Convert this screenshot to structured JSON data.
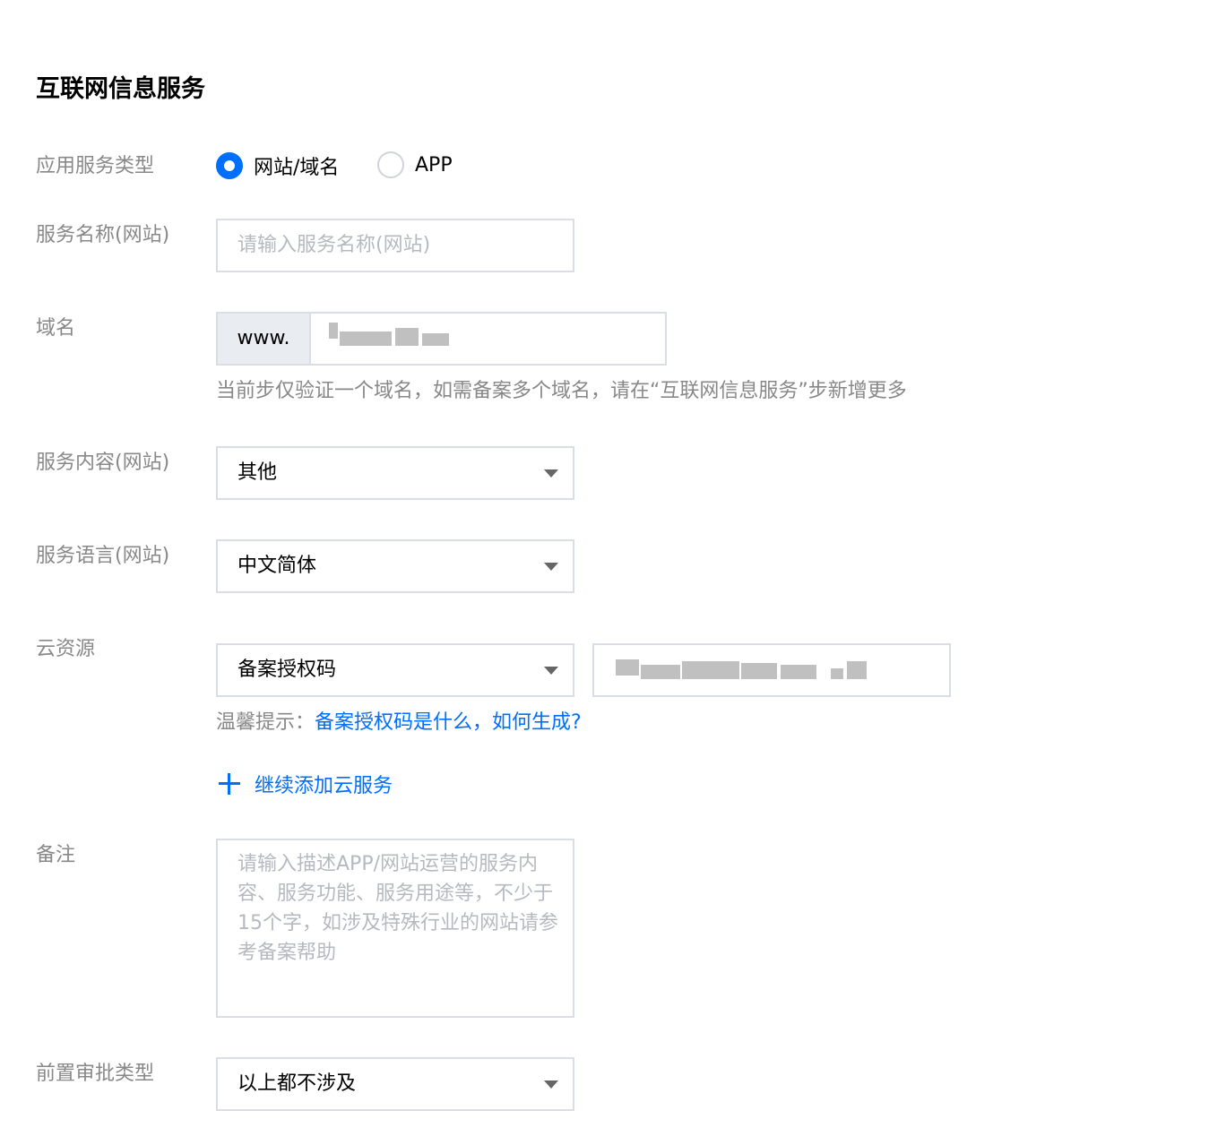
{
  "section_title": "互联网信息服务",
  "service_type": {
    "label": "应用服务类型",
    "options": [
      "网站/域名",
      "APP"
    ],
    "selected": "网站/域名"
  },
  "service_name": {
    "label": "服务名称(网站)",
    "placeholder": "请输入服务名称(网站)"
  },
  "domain": {
    "label": "域名",
    "prefix": "www.",
    "hint": "当前步仅验证一个域名，如需备案多个域名，请在“互联网信息服务”步新增更多"
  },
  "service_content": {
    "label": "服务内容(网站)",
    "value": "其他"
  },
  "service_language": {
    "label": "服务语言(网站)",
    "value": "中文简体"
  },
  "cloud_resource": {
    "label": "云资源",
    "type_value": "备案授权码",
    "tip_prefix": "温馨提示：",
    "tip_link": "备案授权码是什么，如何生成?",
    "add_label": "继续添加云服务"
  },
  "remark": {
    "label": "备注",
    "placeholder": "请输入描述APP/网站运营的服务内容、服务功能、服务用途等，不少于15个字，如涉及特殊行业的网站请参考备案帮助"
  },
  "pre_approval": {
    "label": "前置审批类型",
    "value": "以上都不涉及"
  },
  "colors": {
    "accent": "#006eff",
    "label": "#888888",
    "border": "#d9dde4",
    "placeholder": "#b6b9c0"
  }
}
